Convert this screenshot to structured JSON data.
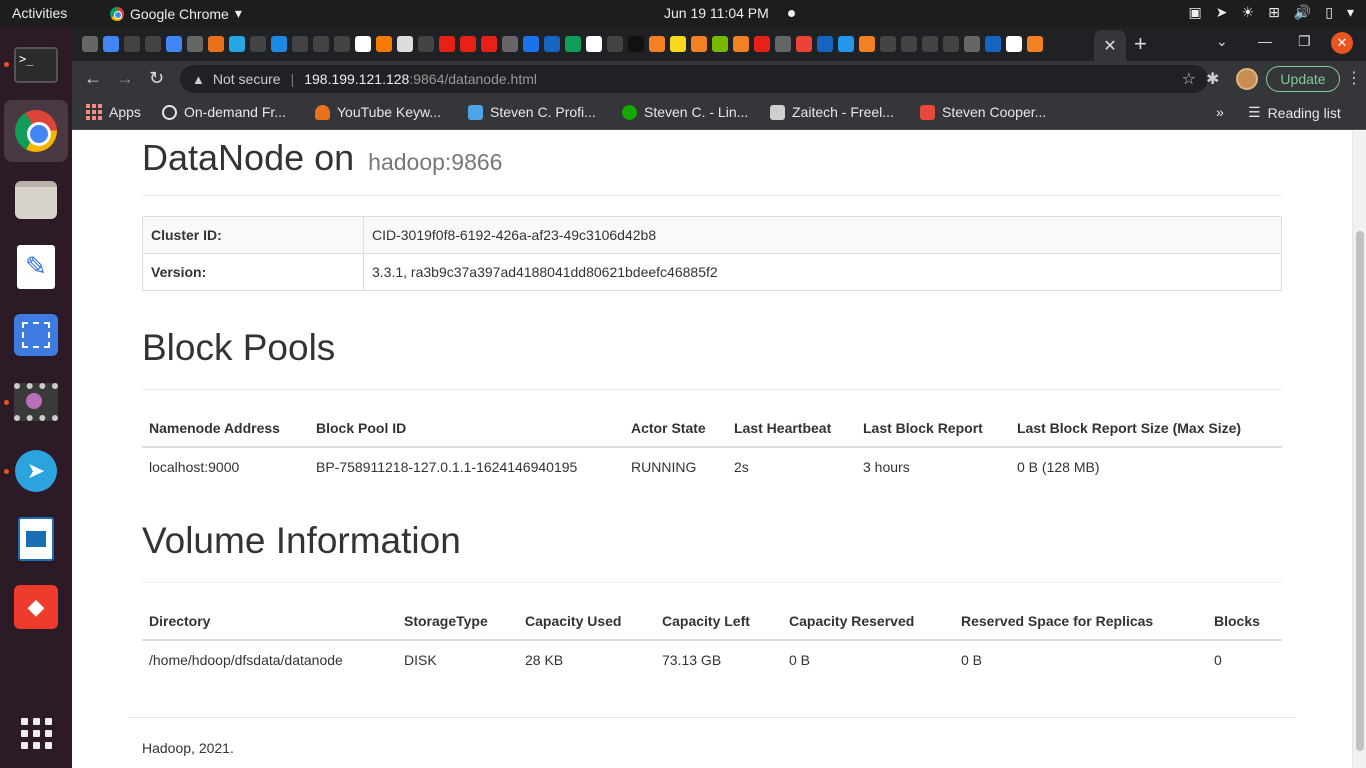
{
  "topbar": {
    "activities": "Activities",
    "app_name": "Google Chrome",
    "clock": "Jun 19  11:04 PM"
  },
  "dock": {
    "apps": [
      "terminal",
      "chrome",
      "files",
      "text-editor",
      "screenshot",
      "video-player",
      "telegram",
      "document-viewer",
      "anydesk"
    ]
  },
  "browser": {
    "address": {
      "security": "Not secure",
      "host": "198.199.121.128",
      "path": ":9864/datanode.html"
    },
    "update_label": "Update",
    "bookmarks": [
      {
        "label": "Apps",
        "color": "#f28b82"
      },
      {
        "label": "On-demand Fr...",
        "color": "#e8e8e8"
      },
      {
        "label": "YouTube Keyw...",
        "color": "#e8711a"
      },
      {
        "label": "Steven C. Profi...",
        "color": "#4ea4e6"
      },
      {
        "label": "Steven C. - Lin...",
        "color": "#14a800"
      },
      {
        "label": "Zaitech - Freel...",
        "color": "#cfcfcf"
      },
      {
        "label": "Steven Cooper...",
        "color": "#e6483b"
      }
    ],
    "reading_list": "Reading list"
  },
  "page": {
    "title": "DataNode on",
    "title_host": "hadoop:9866",
    "info": {
      "cluster_label": "Cluster ID:",
      "cluster_value": "CID-3019f0f8-6192-426a-af23-49c3106d42b8",
      "version_label": "Version:",
      "version_value": "3.3.1, ra3b9c37a397ad4188041dd80621bdeefc46885f2"
    },
    "block_pools": {
      "heading": "Block Pools",
      "headers": [
        "Namenode Address",
        "Block Pool ID",
        "Actor State",
        "Last Heartbeat",
        "Last Block Report",
        "Last Block Report Size (Max Size)"
      ],
      "rows": [
        [
          "localhost:9000",
          "BP-758911218-127.0.1.1-1624146940195",
          "RUNNING",
          "2s",
          "3 hours",
          "0 B (128 MB)"
        ]
      ]
    },
    "volumes": {
      "heading": "Volume Information",
      "headers": [
        "Directory",
        "StorageType",
        "Capacity Used",
        "Capacity Left",
        "Capacity Reserved",
        "Reserved Space for Replicas",
        "Blocks"
      ],
      "rows": [
        [
          "/home/hdoop/dfsdata/datanode",
          "DISK",
          "28 KB",
          "73.13 GB",
          "0 B",
          "0 B",
          "0"
        ]
      ]
    },
    "footer": "Hadoop, 2021."
  }
}
